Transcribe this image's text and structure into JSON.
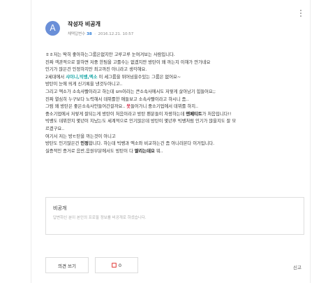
{
  "post": {
    "avatar_letter": "A",
    "author": "작성자 비공개",
    "answer_label": "채택답변수",
    "answer_count": "38",
    "date": "2016.12.21. 10:57",
    "lines": [
      [
        {
          "t": "ㅎㅎ저는 딱히 좋아하는그룹은없지만 고루고루 눈여겨보는 사람입니다."
        }
      ],
      [
        {
          "t": "진짜 객관적으로 말하면 저중 한팀을 고를수는 없겠지만 방탄이 왜 까는지 이해가 안가네요"
        }
      ],
      [
        {
          "t": "인기가 많은건 인정하지만 최고까진 아니라고 생각해요."
        }
      ],
      [
        {
          "t": "2세대에서 "
        },
        {
          "t": "샤이니,빅뱅,엑소",
          "c": "hl-teal"
        },
        {
          "t": " 이 세그룹을 뛰어넘을수있는 그룹은 없어요~"
        }
      ],
      [
        {
          "t": "방탄이 눈에 띄게 신기록을 낸것두아니고.."
        }
      ],
      [
        {
          "t": "그리고 엑소가 소속사빨이라고 하는데 sm이라는 큰소속사에서도 저렇게 살아남기 힘들어요;;"
        }
      ],
      [
        {
          "t": "진짜 열심히 누구보다 노력해서 데뷔를한 애들보고 소속사빨이라고 하시니 좀.."
        }
      ],
      [
        {
          "t": "그럼 왜 방탄은 좋은소속사안들어간걸까요.. "
        },
        {
          "t": "못",
          "c": "hl-red"
        },
        {
          "t": "들어가니 중소기업에서 데뷔를 하지.."
        }
      ],
      [
        {
          "t": "중소기업에서 저렇게 잘되는게 방탄이 처음이라고 방탄 팬분들이 자랑하는데 "
        },
        {
          "t": "엔페티트",
          "c": "hl-blue"
        },
        {
          "t": "가 처음입니다!!"
        }
      ],
      [
        {
          "t": "빅뱅도 데뷔한지 몇년이 지났는도 세계적으로 인기많은데 방탄이 몇년후 빅뱅처럼 인기가 많을지도 잘 모"
        }
      ],
      [
        {
          "t": "르겠구요.."
        }
      ],
      [
        {
          "t": "여기서 저는 방ㅌ탄을 까는것이 아니고"
        }
      ],
      [
        {
          "t": "방탄도 인기많은건 "
        },
        {
          "t": "인정",
          "c": "hl-blue"
        },
        {
          "t": "합니다. 하는데 빅뱅과 엑소와 비교하는건 좀 아니라본다 이거입니다."
        }
      ],
      [
        {
          "t": "실증적인 증거로 음반,음원부분에서도 방탄이 다 "
        },
        {
          "t": "딸리는데요",
          "c": "hl-blue"
        },
        {
          "t": " 뭐.."
        }
      ]
    ]
  },
  "comment_box": {
    "name": "비공개",
    "placeholder": "답변하신 분이 본인의 프로필 정보를 비공개로 하셨습니다."
  },
  "actions": {
    "comment_label": "의견 쓰기",
    "like_count": "0",
    "report_label": "신고"
  },
  "colors": {
    "avatar": "#6a8fd8",
    "highlight_teal": "#1aa7a7",
    "highlight_red": "#d9324f",
    "answer_count": "#2b7bd6"
  }
}
